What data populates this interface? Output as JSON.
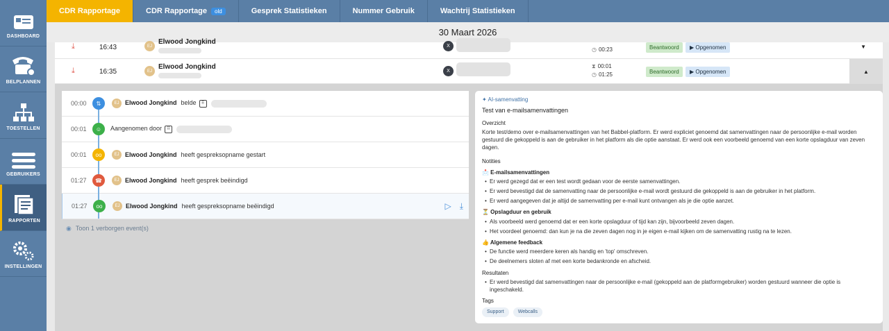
{
  "sidebar": {
    "items": [
      {
        "label": "DASHBOARD",
        "icon": "dashboard-icon",
        "active": false
      },
      {
        "label": "BELPLANNEN",
        "icon": "phone-gear-icon",
        "active": false
      },
      {
        "label": "TOESTELLEN",
        "icon": "hierarchy-icon",
        "active": false
      },
      {
        "label": "GEBRUIKERS",
        "icon": "users-bars-icon",
        "active": false
      },
      {
        "label": "RAPPORTEN",
        "icon": "reports-icon",
        "active": true
      },
      {
        "label": "INSTELLINGEN",
        "icon": "gears-icon",
        "active": false
      }
    ]
  },
  "tabs": [
    {
      "label": "CDR Rapportage",
      "active": true
    },
    {
      "label": "CDR Rapportage",
      "badge": "old",
      "active": false
    },
    {
      "label": "Gesprek Statistieken",
      "active": false
    },
    {
      "label": "Nummer Gebruik",
      "active": false
    },
    {
      "label": "Wachtrij Statistieken",
      "active": false
    }
  ],
  "date": "30 Maart 2026",
  "calls": [
    {
      "time": "16:43",
      "initials": "EJ",
      "name": "Elwood Jongkind",
      "x": "X",
      "dur1": "",
      "dur2": "00:23",
      "status": "Beantwoord",
      "recording": "Opgenomen"
    },
    {
      "time": "16:35",
      "initials": "EJ",
      "name": "Elwood Jongkind",
      "x": "X",
      "dur1": "00:01",
      "dur2": "01:25",
      "status": "Beantwoord",
      "recording": "Opgenomen"
    }
  ],
  "events": [
    {
      "time": "00:00",
      "initials": "EJ",
      "name": "Elwood Jongkind",
      "action": "belde",
      "color": "#3d8fe0",
      "icon": "call-route-icon"
    },
    {
      "time": "00:01",
      "text": "Aangenomen door",
      "color": "#3db04a",
      "icon": "person-icon"
    },
    {
      "time": "00:01",
      "initials": "EJ",
      "name": "Elwood Jongkind",
      "action": "heeft gespreksopname gestart",
      "color": "#f4b400",
      "icon": "voicemail-icon"
    },
    {
      "time": "01:27",
      "initials": "EJ",
      "name": "Elwood Jongkind",
      "action": "heeft gesprek beëindigd",
      "color": "#e05a3e",
      "icon": "hangup-icon"
    },
    {
      "time": "01:27",
      "initials": "EJ",
      "name": "Elwood Jongkind",
      "action": "heeft gespreksopname beëindigd",
      "color": "#3db04a",
      "icon": "voicemail-icon"
    }
  ],
  "hidden_events": "Toon 1 verborgen event(s)",
  "ai": {
    "header": "AI-samenvatting",
    "title": "Test van e-mailsamenvattingen",
    "overview_h": "Overzicht",
    "overview": "Korte test/demo over e-mailsamenvattingen van het Babbel-platform. Er werd expliciet genoemd dat samenvattingen naar de persoonlijke e-mail worden gestuurd die gekoppeld is aan de gebruiker in het platform als die optie aanstaat. Er werd ook een voorbeeld genoemd van een korte opslagduur van zeven dagen.",
    "notes_h": "Notities",
    "sections": [
      {
        "title": "📩 E-mailsamenvattingen",
        "items": [
          "Er werd gezegd dat er een test wordt gedaan voor de eerste samenvattingen.",
          "Er werd bevestigd dat de samenvatting naar de persoonlijke e-mail wordt gestuurd die gekoppeld is aan de gebruiker in het platform.",
          "Er werd aangegeven dat je altijd de samenvatting per e-mail kunt ontvangen als je die optie aanzet."
        ]
      },
      {
        "title": "⏳ Opslagduur en gebruik",
        "items": [
          "Als voorbeeld werd genoemd dat er een korte opslagduur of tijd kan zijn, bijvoorbeeld zeven dagen.",
          "Het voordeel genoemd: dan kun je na die zeven dagen nog in je eigen e-mail kijken om de samenvatting rustig na te lezen."
        ]
      },
      {
        "title": "👍 Algemene feedback",
        "items": [
          "De functie werd meerdere keren als handig en 'top' omschreven.",
          "De deelnemers sloten af met een korte bedankronde en afscheid."
        ]
      }
    ],
    "results_h": "Resultaten",
    "results": [
      "Er werd bevestigd dat samenvattingen naar de persoonlijke e-mail (gekoppeld aan de platformgebruiker) worden gestuurd wanneer die optie is ingeschakeld."
    ],
    "tags_h": "Tags",
    "tags": [
      "Support",
      "Webcalls"
    ]
  }
}
